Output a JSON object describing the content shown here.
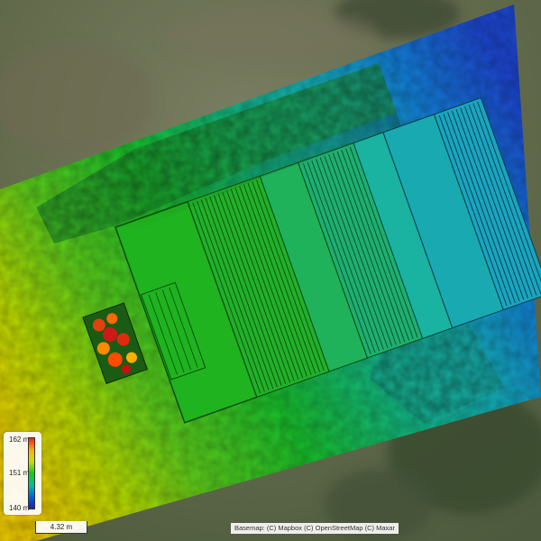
{
  "map": {
    "legend": {
      "max_label": "162 m",
      "mid_label": "151 m",
      "min_label": "140 m",
      "colors": [
        "#ff1a1a",
        "#ffb000",
        "#c8e000",
        "#18c818",
        "#00c0a0",
        "#0060e0",
        "#2020b0"
      ]
    },
    "scale_bar": {
      "label": "4.32 m"
    },
    "attribution": "Basemap: (C) Mapbox (C) OpenStreetMap (C) Maxar"
  }
}
